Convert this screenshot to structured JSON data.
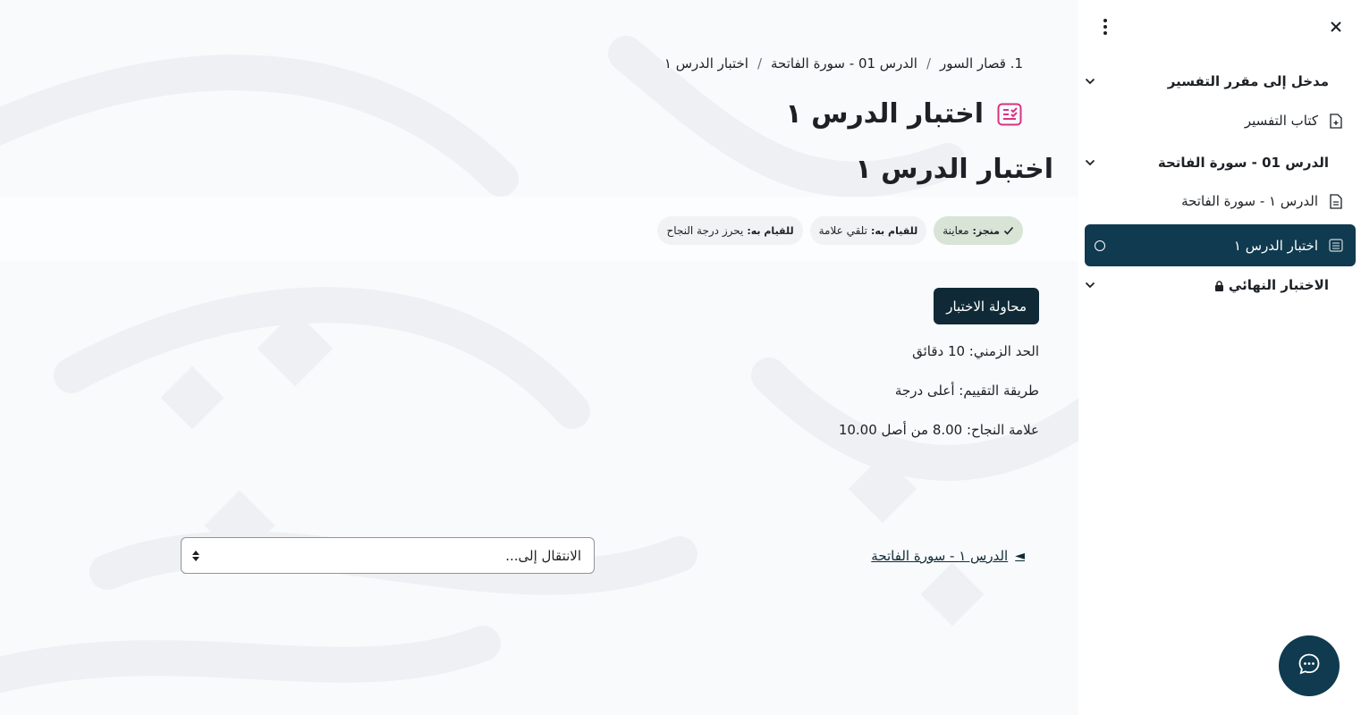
{
  "breadcrumb": {
    "items": [
      "1. قصار السور",
      "الدرس 01 - سورة الفاتحة",
      "اختبار الدرس ١"
    ],
    "separator": "/"
  },
  "page": {
    "title": "اختبار الدرس ١",
    "heading": "اختبار الدرس ١",
    "icon": "quiz-icon"
  },
  "completion": {
    "done": {
      "prefix": "منجز:",
      "value": "معاينة"
    },
    "todo1": {
      "prefix": "للقيام به:",
      "value": "تلقي علامة"
    },
    "todo2": {
      "prefix": "للقيام به:",
      "value": "يحرز درجة النجاح"
    }
  },
  "quiz": {
    "attempt_label": "محاولة الاختبار",
    "time_limit": "الحد الزمني: 10 دقائق",
    "grading_method": "طريقة التقييم: أعلى درجة",
    "pass_grade": "علامة النجاح: 8.00 من أصل 10.00"
  },
  "navigation": {
    "prev_label": "الدرس ١  -  سورة الفاتحة",
    "jump_placeholder": "الانتقال إلى..."
  },
  "sidebar": {
    "sections": [
      {
        "label": "مدخل إلى مقرر التفسير"
      },
      {
        "label": "الدرس 01 - سورة الفاتحة"
      },
      {
        "label": "الاختبار النهائي"
      }
    ],
    "items": [
      {
        "label": "كتاب التفسير",
        "icon": "book-icon"
      },
      {
        "label": "الدرس ١ - سورة الفاتحة",
        "icon": "page-icon"
      },
      {
        "label": "اختبار الدرس ١",
        "icon": "quiz-icon"
      }
    ]
  },
  "colors": {
    "primary": "#0f2a36",
    "active": "#0f3a4f",
    "accent_pink": "#d63384",
    "done_badge": "#d7e4d6"
  }
}
